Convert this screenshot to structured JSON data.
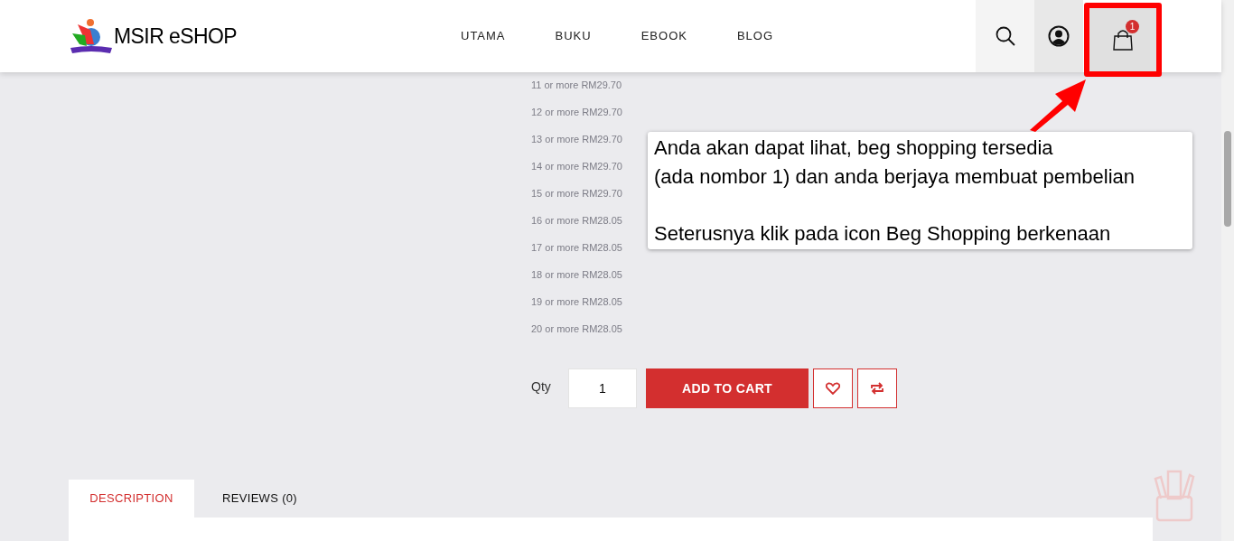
{
  "header": {
    "logo_text": "MSIR eSHOP",
    "nav": [
      {
        "label": "UTAMA"
      },
      {
        "label": "BUKU"
      },
      {
        "label": "EBOOK"
      },
      {
        "label": "BLOG"
      }
    ],
    "cart_count": "1"
  },
  "price_tiers": [
    "11 or more RM29.70",
    "12 or more RM29.70",
    "13 or more RM29.70",
    "14 or more RM29.70",
    "15 or more RM29.70",
    "16 or more RM28.05",
    "17 or more RM28.05",
    "18 or more RM28.05",
    "19 or more RM28.05",
    "20 or more RM28.05"
  ],
  "purchase": {
    "qty_label": "Qty",
    "qty_value": "1",
    "add_button": "ADD TO CART"
  },
  "tabs": [
    {
      "label": "DESCRIPTION",
      "selected": true
    },
    {
      "label": "REVIEWS (0)",
      "selected": false
    }
  ],
  "annotation": {
    "lines": [
      "Anda akan dapat lihat, beg shopping tersedia",
      "(ada nombor 1) dan anda berjaya membuat pembelian",
      "Seterusnya klik pada icon Beg Shopping berkenaan"
    ]
  }
}
